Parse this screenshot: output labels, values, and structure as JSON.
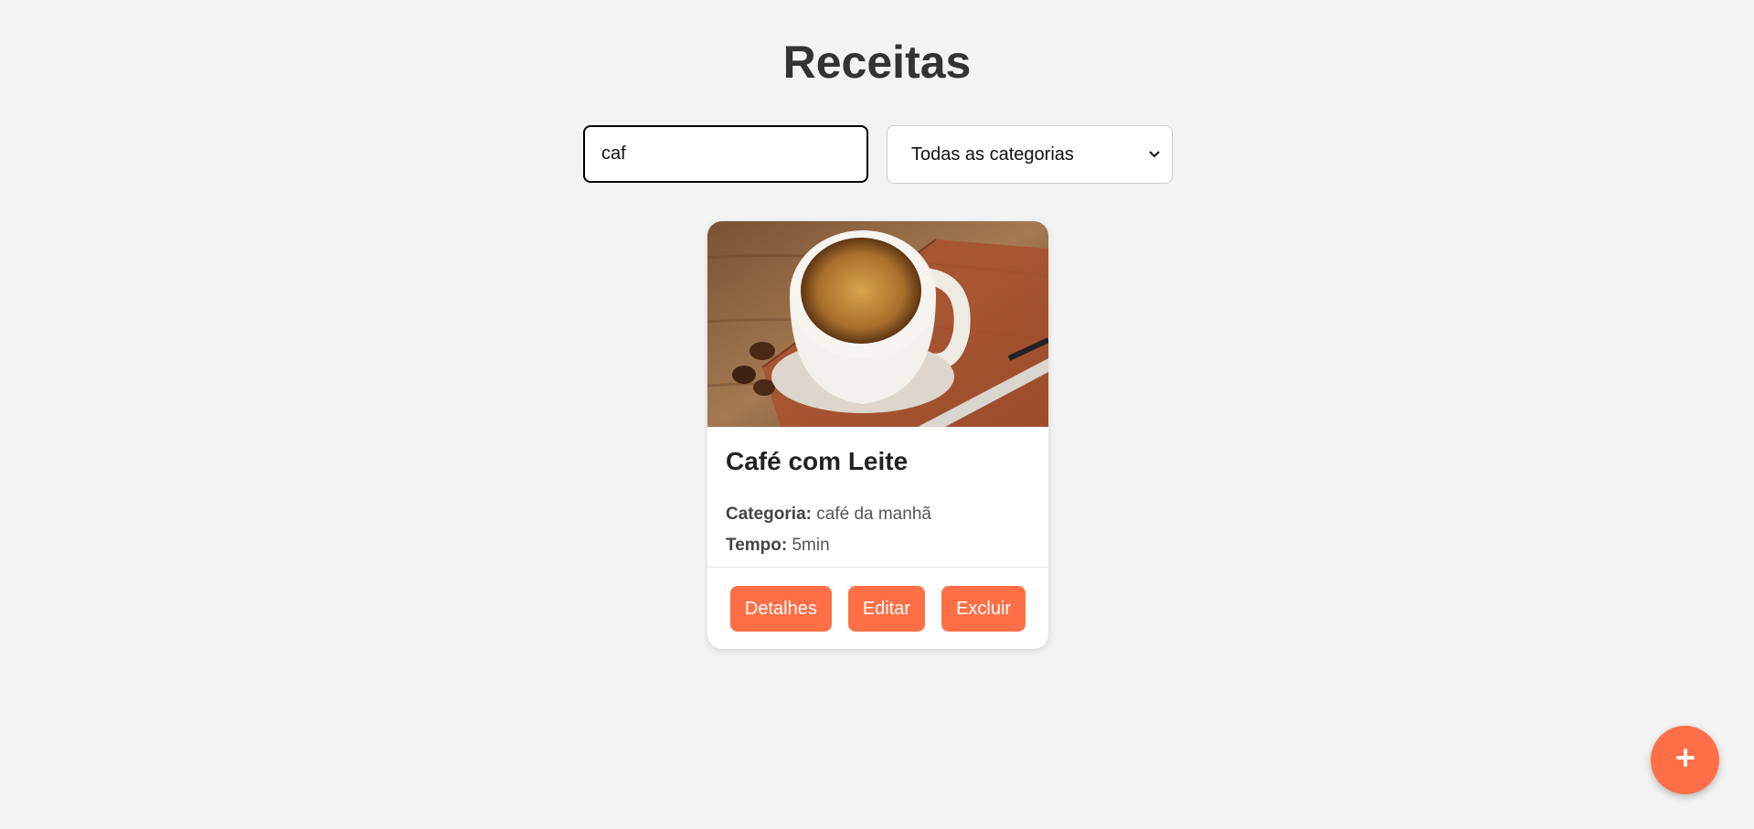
{
  "header": {
    "title": "Receitas"
  },
  "filters": {
    "search_value": "caf",
    "category_selected": "Todas as categorias"
  },
  "recipes": [
    {
      "title": "Café com Leite",
      "category_label": "Categoria:",
      "category_value": "café da manhã",
      "time_label": "Tempo:",
      "time_value": "5min",
      "image_icon": "coffee-cup-photo",
      "actions": {
        "details": "Detalhes",
        "edit": "Editar",
        "delete": "Excluir"
      }
    }
  ],
  "fab": {
    "label": "+",
    "icon": "plus-icon"
  },
  "colors": {
    "accent": "#ff6f47",
    "background": "#f3f3f3",
    "card": "#ffffff",
    "title": "#333333"
  }
}
